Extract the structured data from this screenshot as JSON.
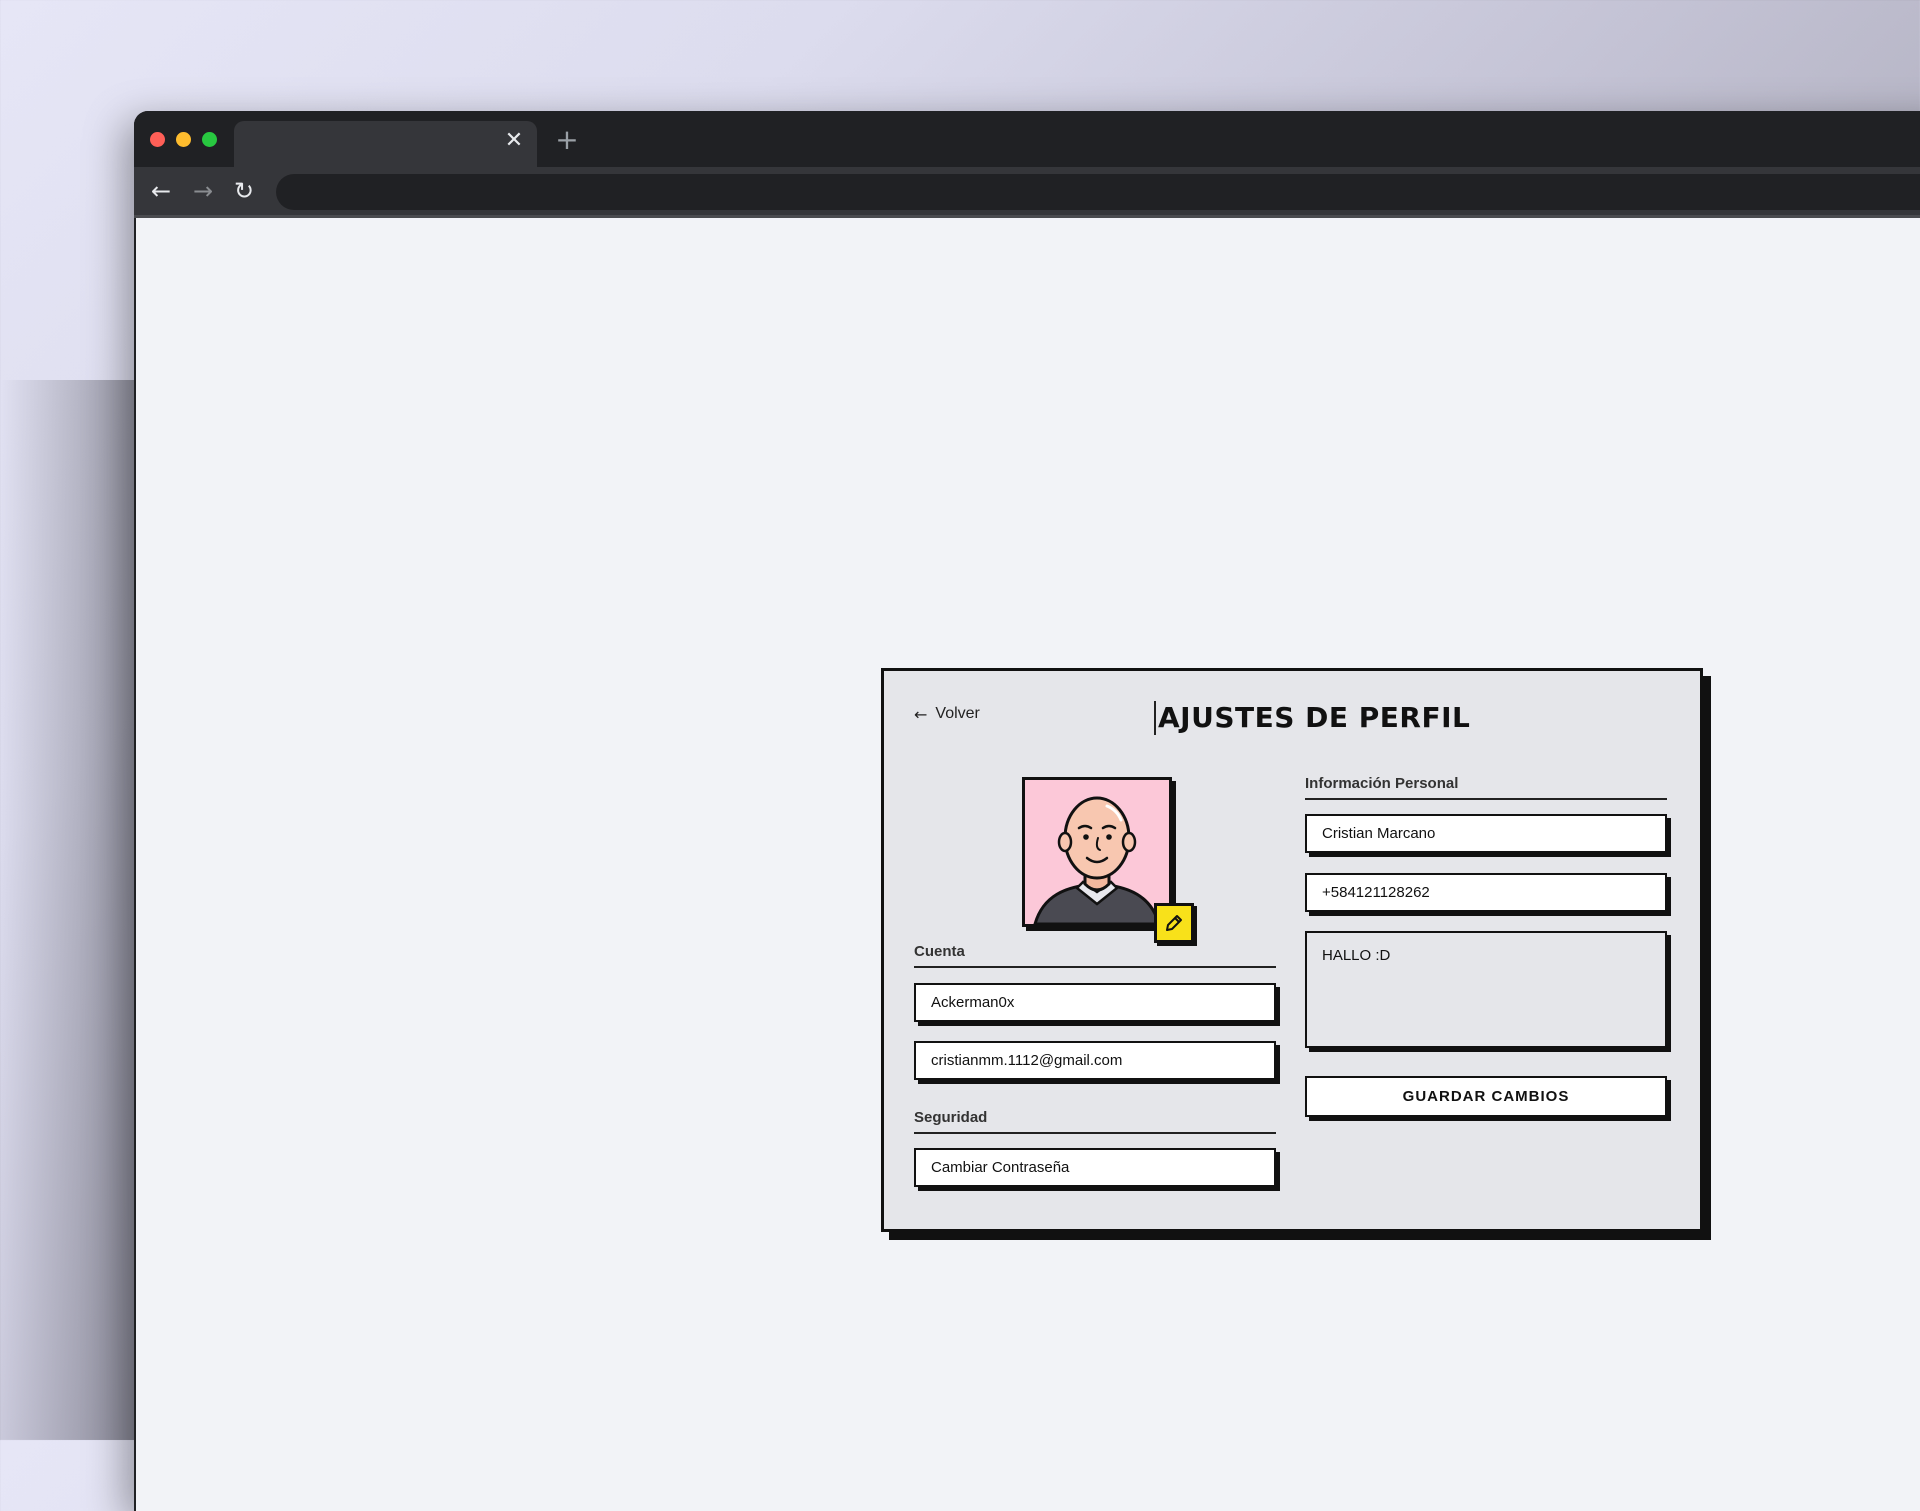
{
  "browser": {
    "tab_close": "✕",
    "new_tab": "+",
    "nav_back": "←",
    "nav_forward": "→",
    "nav_reload": "↻"
  },
  "profile": {
    "back_arrow": "←",
    "back_label": "Volver",
    "title": "AJUSTES DE PERFIL",
    "avatar_icon": "user-portrait",
    "edit_icon": "pencil-icon",
    "account": {
      "label": "Cuenta",
      "username": "Ackerman0x",
      "email": "cristianmm.1112@gmail.com"
    },
    "security": {
      "label": "Seguridad",
      "change_password": "Cambiar Contraseña"
    },
    "personal": {
      "label": "Información Personal",
      "name": "Cristian Marcano",
      "phone": "+584121128262",
      "bio": "HALLO :D"
    },
    "save_label": "GUARDAR CAMBIOS"
  },
  "colors": {
    "card_bg": "#e5e6ea",
    "avatar_bg": "#fcc8d8",
    "edit_accent": "#f8e11a",
    "border": "#111111"
  }
}
